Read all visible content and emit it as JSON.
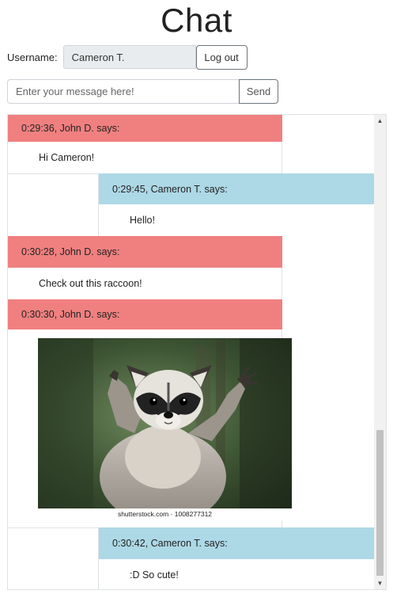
{
  "page": {
    "title": "Chat"
  },
  "user": {
    "label": "Username:",
    "value": "Cameron T.",
    "logout_label": "Log out"
  },
  "composer": {
    "placeholder": "Enter your message here!",
    "send_label": "Send"
  },
  "messages": [
    {
      "header": "0:29:36, John D. says:",
      "body": "Hi Cameron!"
    },
    {
      "header": "0:29:45, Cameron T. says:",
      "body": "Hello!"
    },
    {
      "header": "0:30:28, John D. says:",
      "body": "Check out this raccoon!"
    },
    {
      "header": "0:30:30, John D. says:",
      "image_caption": "shutterstock.com · 1008277312"
    },
    {
      "header": "0:30:42, Cameron T. says:",
      "body": ":D So cute!"
    }
  ],
  "colors": {
    "john_header": "#f08080",
    "cameron_header": "#add8e6",
    "input_bg": "#e9ecef"
  },
  "icons": {
    "scroll_up": "triangle-up",
    "scroll_down": "triangle-down"
  }
}
